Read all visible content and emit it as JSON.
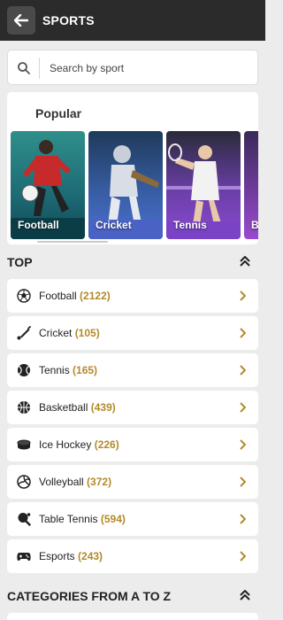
{
  "header": {
    "title": "SPORTS",
    "back_icon": "arrow-left-icon"
  },
  "search": {
    "placeholder": "Search by sport",
    "icon": "search-icon"
  },
  "popular": {
    "title": "Popular",
    "cards": [
      {
        "label": "Football"
      },
      {
        "label": "Cricket"
      },
      {
        "label": "Tennis"
      },
      {
        "label": "B"
      }
    ]
  },
  "top": {
    "title": "TOP",
    "toggle_icon": "double-chevron-up-icon",
    "items": [
      {
        "name": "Football",
        "count": "(2122)",
        "icon": "football-icon"
      },
      {
        "name": "Cricket",
        "count": "(105)",
        "icon": "cricket-bat-icon"
      },
      {
        "name": "Tennis",
        "count": "(165)",
        "icon": "tennis-ball-icon"
      },
      {
        "name": "Basketball",
        "count": "(439)",
        "icon": "basketball-icon"
      },
      {
        "name": "Ice Hockey",
        "count": "(226)",
        "icon": "ice-hockey-puck-icon"
      },
      {
        "name": "Volleyball",
        "count": "(372)",
        "icon": "volleyball-icon"
      },
      {
        "name": "Table Tennis",
        "count": "(594)",
        "icon": "table-tennis-icon"
      },
      {
        "name": "Esports",
        "count": "(243)",
        "icon": "gamepad-icon"
      }
    ]
  },
  "categories": {
    "title": "CATEGORIES FROM A TO Z",
    "toggle_icon": "double-chevron-up-icon"
  },
  "colors": {
    "header_bg": "#2b2b2b",
    "accent_gold": "#b38a2a",
    "page_bg": "#ececec"
  }
}
